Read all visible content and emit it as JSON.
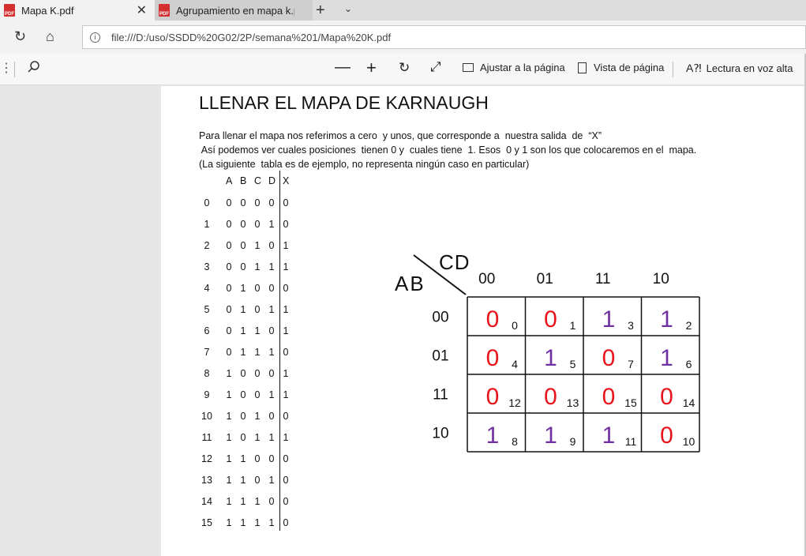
{
  "tabs": [
    {
      "title": "Mapa K.pdf",
      "icon": "pdf-icon"
    },
    {
      "title": "Agrupamiento en mapa k.pdf",
      "icon": "pdf-icon"
    }
  ],
  "address": {
    "url": "file:///D:/uso/SSDD%20G02/2P/semana%201/Mapa%20K.pdf"
  },
  "toolbar": {
    "fit_page": "Ajustar a la página",
    "page_view": "Vista de página",
    "read_aloud": "Lectura en voz alta"
  },
  "doc": {
    "heading": "LLENAR EL MAPA DE KARNAUGH",
    "line1": "Para llenar el mapa nos referimos a cero  y unos, que corresponde a  nuestra salida  de  “X”",
    "line2": " Así podemos ver cuales posiciones  tienen 0 y  cuales tiene  1. Esos  0 y 1 son los que colocaremos en el  mapa.",
    "line3": "(La siguiente  tabla es de ejemplo, no representa ningún caso en particular)"
  },
  "truth_table": {
    "headers": [
      "A",
      "B",
      "C",
      "D",
      "X"
    ],
    "rows": [
      {
        "n": "0",
        "v": [
          "0",
          "0",
          "0",
          "0",
          "0"
        ]
      },
      {
        "n": "1",
        "v": [
          "0",
          "0",
          "0",
          "1",
          "0"
        ]
      },
      {
        "n": "2",
        "v": [
          "0",
          "0",
          "1",
          "0",
          "1"
        ]
      },
      {
        "n": "3",
        "v": [
          "0",
          "0",
          "1",
          "1",
          "1"
        ]
      },
      {
        "n": "4",
        "v": [
          "0",
          "1",
          "0",
          "0",
          "0"
        ]
      },
      {
        "n": "5",
        "v": [
          "0",
          "1",
          "0",
          "1",
          "1"
        ]
      },
      {
        "n": "6",
        "v": [
          "0",
          "1",
          "1",
          "0",
          "1"
        ]
      },
      {
        "n": "7",
        "v": [
          "0",
          "1",
          "1",
          "1",
          "0"
        ]
      },
      {
        "n": "8",
        "v": [
          "1",
          "0",
          "0",
          "0",
          "1"
        ]
      },
      {
        "n": "9",
        "v": [
          "1",
          "0",
          "0",
          "1",
          "1"
        ]
      },
      {
        "n": "10",
        "v": [
          "1",
          "0",
          "1",
          "0",
          "0"
        ]
      },
      {
        "n": "11",
        "v": [
          "1",
          "0",
          "1",
          "1",
          "1"
        ]
      },
      {
        "n": "12",
        "v": [
          "1",
          "1",
          "0",
          "0",
          "0"
        ]
      },
      {
        "n": "13",
        "v": [
          "1",
          "1",
          "0",
          "1",
          "0"
        ]
      },
      {
        "n": "14",
        "v": [
          "1",
          "1",
          "1",
          "0",
          "0"
        ]
      },
      {
        "n": "15",
        "v": [
          "1",
          "1",
          "1",
          "1",
          "0"
        ]
      }
    ]
  },
  "kmap": {
    "row_var": "AB",
    "col_var": "CD",
    "col_labels": [
      "00",
      "01",
      "11",
      "10"
    ],
    "row_labels": [
      "00",
      "01",
      "11",
      "10"
    ],
    "cells": [
      [
        {
          "v": "0",
          "m": "0"
        },
        {
          "v": "0",
          "m": "1"
        },
        {
          "v": "1",
          "m": "3"
        },
        {
          "v": "1",
          "m": "2"
        }
      ],
      [
        {
          "v": "0",
          "m": "4"
        },
        {
          "v": "1",
          "m": "5"
        },
        {
          "v": "0",
          "m": "7"
        },
        {
          "v": "1",
          "m": "6"
        }
      ],
      [
        {
          "v": "0",
          "m": "12"
        },
        {
          "v": "0",
          "m": "13"
        },
        {
          "v": "0",
          "m": "15"
        },
        {
          "v": "0",
          "m": "14"
        }
      ],
      [
        {
          "v": "1",
          "m": "8"
        },
        {
          "v": "1",
          "m": "9"
        },
        {
          "v": "1",
          "m": "11"
        },
        {
          "v": "0",
          "m": "10"
        }
      ]
    ],
    "colors": {
      "zero": "#e8141c",
      "one": "#7030a0"
    }
  }
}
